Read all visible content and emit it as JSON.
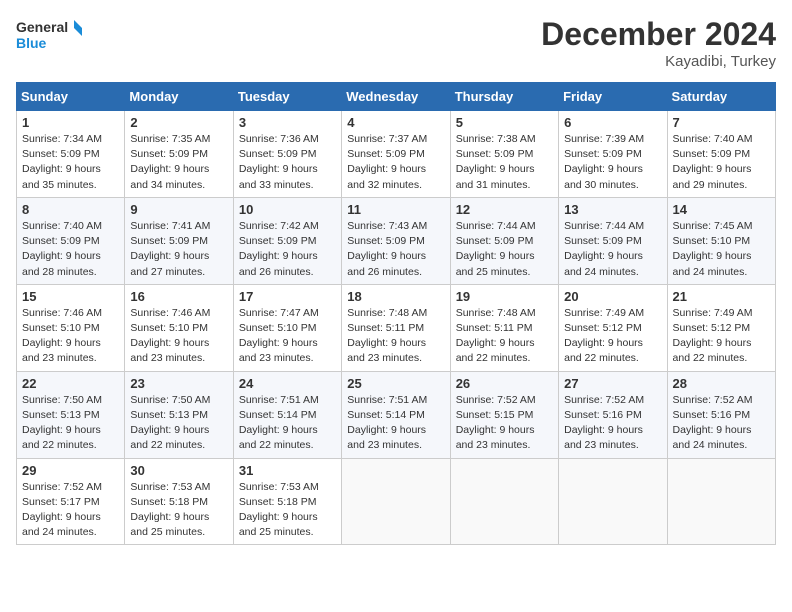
{
  "header": {
    "logo_line1": "General",
    "logo_line2": "Blue",
    "month": "December 2024",
    "location": "Kayadibi, Turkey"
  },
  "weekdays": [
    "Sunday",
    "Monday",
    "Tuesday",
    "Wednesday",
    "Thursday",
    "Friday",
    "Saturday"
  ],
  "weeks": [
    [
      {
        "day": "1",
        "info": "Sunrise: 7:34 AM\nSunset: 5:09 PM\nDaylight: 9 hours\nand 35 minutes."
      },
      {
        "day": "2",
        "info": "Sunrise: 7:35 AM\nSunset: 5:09 PM\nDaylight: 9 hours\nand 34 minutes."
      },
      {
        "day": "3",
        "info": "Sunrise: 7:36 AM\nSunset: 5:09 PM\nDaylight: 9 hours\nand 33 minutes."
      },
      {
        "day": "4",
        "info": "Sunrise: 7:37 AM\nSunset: 5:09 PM\nDaylight: 9 hours\nand 32 minutes."
      },
      {
        "day": "5",
        "info": "Sunrise: 7:38 AM\nSunset: 5:09 PM\nDaylight: 9 hours\nand 31 minutes."
      },
      {
        "day": "6",
        "info": "Sunrise: 7:39 AM\nSunset: 5:09 PM\nDaylight: 9 hours\nand 30 minutes."
      },
      {
        "day": "7",
        "info": "Sunrise: 7:40 AM\nSunset: 5:09 PM\nDaylight: 9 hours\nand 29 minutes."
      }
    ],
    [
      {
        "day": "8",
        "info": "Sunrise: 7:40 AM\nSunset: 5:09 PM\nDaylight: 9 hours\nand 28 minutes."
      },
      {
        "day": "9",
        "info": "Sunrise: 7:41 AM\nSunset: 5:09 PM\nDaylight: 9 hours\nand 27 minutes."
      },
      {
        "day": "10",
        "info": "Sunrise: 7:42 AM\nSunset: 5:09 PM\nDaylight: 9 hours\nand 26 minutes."
      },
      {
        "day": "11",
        "info": "Sunrise: 7:43 AM\nSunset: 5:09 PM\nDaylight: 9 hours\nand 26 minutes."
      },
      {
        "day": "12",
        "info": "Sunrise: 7:44 AM\nSunset: 5:09 PM\nDaylight: 9 hours\nand 25 minutes."
      },
      {
        "day": "13",
        "info": "Sunrise: 7:44 AM\nSunset: 5:09 PM\nDaylight: 9 hours\nand 24 minutes."
      },
      {
        "day": "14",
        "info": "Sunrise: 7:45 AM\nSunset: 5:10 PM\nDaylight: 9 hours\nand 24 minutes."
      }
    ],
    [
      {
        "day": "15",
        "info": "Sunrise: 7:46 AM\nSunset: 5:10 PM\nDaylight: 9 hours\nand 23 minutes."
      },
      {
        "day": "16",
        "info": "Sunrise: 7:46 AM\nSunset: 5:10 PM\nDaylight: 9 hours\nand 23 minutes."
      },
      {
        "day": "17",
        "info": "Sunrise: 7:47 AM\nSunset: 5:10 PM\nDaylight: 9 hours\nand 23 minutes."
      },
      {
        "day": "18",
        "info": "Sunrise: 7:48 AM\nSunset: 5:11 PM\nDaylight: 9 hours\nand 23 minutes."
      },
      {
        "day": "19",
        "info": "Sunrise: 7:48 AM\nSunset: 5:11 PM\nDaylight: 9 hours\nand 22 minutes."
      },
      {
        "day": "20",
        "info": "Sunrise: 7:49 AM\nSunset: 5:12 PM\nDaylight: 9 hours\nand 22 minutes."
      },
      {
        "day": "21",
        "info": "Sunrise: 7:49 AM\nSunset: 5:12 PM\nDaylight: 9 hours\nand 22 minutes."
      }
    ],
    [
      {
        "day": "22",
        "info": "Sunrise: 7:50 AM\nSunset: 5:13 PM\nDaylight: 9 hours\nand 22 minutes."
      },
      {
        "day": "23",
        "info": "Sunrise: 7:50 AM\nSunset: 5:13 PM\nDaylight: 9 hours\nand 22 minutes."
      },
      {
        "day": "24",
        "info": "Sunrise: 7:51 AM\nSunset: 5:14 PM\nDaylight: 9 hours\nand 22 minutes."
      },
      {
        "day": "25",
        "info": "Sunrise: 7:51 AM\nSunset: 5:14 PM\nDaylight: 9 hours\nand 23 minutes."
      },
      {
        "day": "26",
        "info": "Sunrise: 7:52 AM\nSunset: 5:15 PM\nDaylight: 9 hours\nand 23 minutes."
      },
      {
        "day": "27",
        "info": "Sunrise: 7:52 AM\nSunset: 5:16 PM\nDaylight: 9 hours\nand 23 minutes."
      },
      {
        "day": "28",
        "info": "Sunrise: 7:52 AM\nSunset: 5:16 PM\nDaylight: 9 hours\nand 24 minutes."
      }
    ],
    [
      {
        "day": "29",
        "info": "Sunrise: 7:52 AM\nSunset: 5:17 PM\nDaylight: 9 hours\nand 24 minutes."
      },
      {
        "day": "30",
        "info": "Sunrise: 7:53 AM\nSunset: 5:18 PM\nDaylight: 9 hours\nand 25 minutes."
      },
      {
        "day": "31",
        "info": "Sunrise: 7:53 AM\nSunset: 5:18 PM\nDaylight: 9 hours\nand 25 minutes."
      },
      {
        "day": "",
        "info": ""
      },
      {
        "day": "",
        "info": ""
      },
      {
        "day": "",
        "info": ""
      },
      {
        "day": "",
        "info": ""
      }
    ]
  ]
}
